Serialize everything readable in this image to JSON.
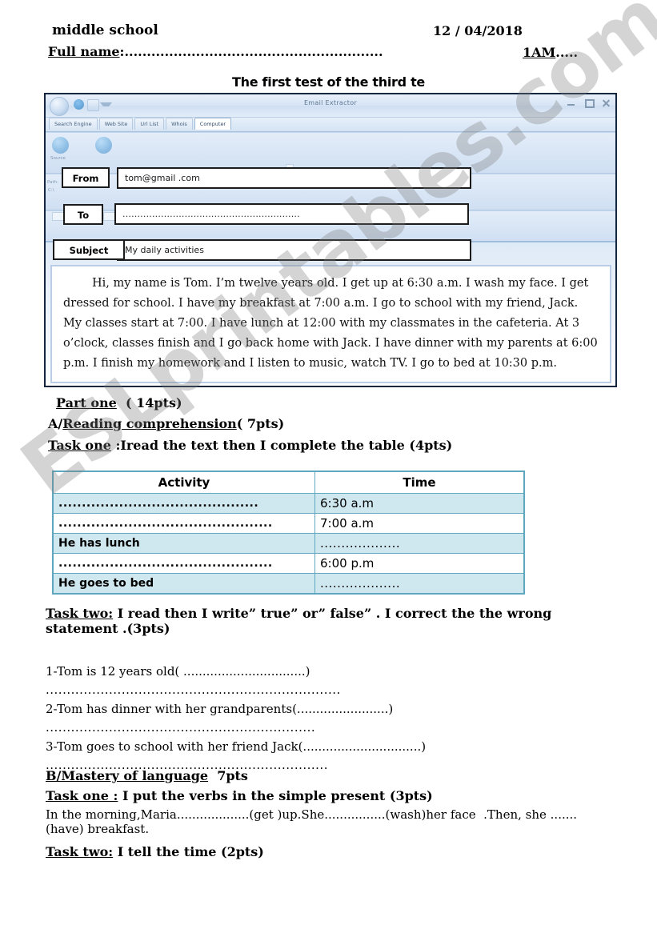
{
  "header": {
    "school": "middle school",
    "date": "12 / 04/2018",
    "full_name_label": "Full name",
    "full_name_dots": ":..........................................................",
    "class_label": "1AM",
    "class_dots": ".....",
    "title": "The first test of the third te"
  },
  "mail_window": {
    "title": "Email Extractor",
    "tabs": [
      {
        "label": "Search Engine",
        "active": false
      },
      {
        "label": "Web Site",
        "active": false
      },
      {
        "label": "Url List",
        "active": false
      },
      {
        "label": "Whois",
        "active": false
      },
      {
        "label": "Computer",
        "active": true
      }
    ],
    "window_controls": [
      "minimize-icon",
      "maximize-icon",
      "close-icon"
    ],
    "chevron": "chevron-down-icon",
    "ghost_labels": {
      "source": "Source",
      "path": "Path:",
      "drive": "C:\\"
    },
    "fields": [
      {
        "label": "From",
        "value": "tom@gmail .com"
      },
      {
        "label": "To",
        "value": "............................................................"
      },
      {
        "label": "Subject",
        "value": "My daily activities"
      }
    ],
    "body_text": "Hi, my name is Tom. I’m twelve years old. I get up at 6:30 a.m.  I wash my face. I get dressed for school. I have my breakfast at 7:00 a.m.  I  go to school with my friend, Jack. My classes start at 7:00. I have lunch at 12:00 with my classmates in the cafeteria. At 3 o’clock, classes finish and I go back home with Jack. I have dinner with my parents at 6:00 p.m.  I finish my homework and I listen to music, watch TV. I go to bed at 10:30 p.m."
  },
  "worksheet": {
    "part_one_label": "Part one",
    "part_one_points": "  ( 14pts)",
    "section_a_prefix": "A/",
    "section_a_label": "Reading comprehension",
    "section_a_points": "( 7pts)",
    "task_one_label": "Task one",
    "task_one_text": " :Iread the text then I complete the table (4pts)",
    "table": {
      "headers": [
        "Activity",
        "Time"
      ],
      "rows": [
        {
          "activity": "...........................................",
          "time": "6:30 a.m",
          "shaded": true
        },
        {
          "activity": "..............................................",
          "time": "7:00 a.m",
          "shaded": false
        },
        {
          "activity": "He has lunch",
          "time": "...................",
          "shaded": true
        },
        {
          "activity": "..............................................",
          "time": "6:00 p.m",
          "shaded": false
        },
        {
          "activity": "He  goes to bed",
          "time": "...................",
          "shaded": true
        }
      ]
    },
    "task_two_label": "Task two:",
    "task_two_text": " I read then I write” true” or” false” . I correct the the wrong statement .(3pts)",
    "questions": [
      {
        "text": "1-Tom is 12 years old( ................................)",
        "answer_dots": "......................................................................"
      },
      {
        "text": "2-Tom has dinner with her grandparents(........................)",
        "answer_dots": "................................................................"
      },
      {
        "text": "3-Tom goes to school with her friend Jack(...............................)",
        "answer_dots": "..................................................................."
      }
    ],
    "section_b_label": "B/Mastery of language",
    "section_b_points": "  7pts",
    "task_one_2_label": "Task one :",
    "task_one_2_text": " I put the verbs in the simple present (3pts)",
    "verbs_text": "In the morning,Maria...................(get )up.She................(wash)her face  .Then, she .......(have) breakfast.",
    "task_two_2_label": "Task two:",
    "task_two_2_text": " I tell the time (2pts)"
  },
  "watermark": {
    "text": "ESLprintables.com"
  }
}
